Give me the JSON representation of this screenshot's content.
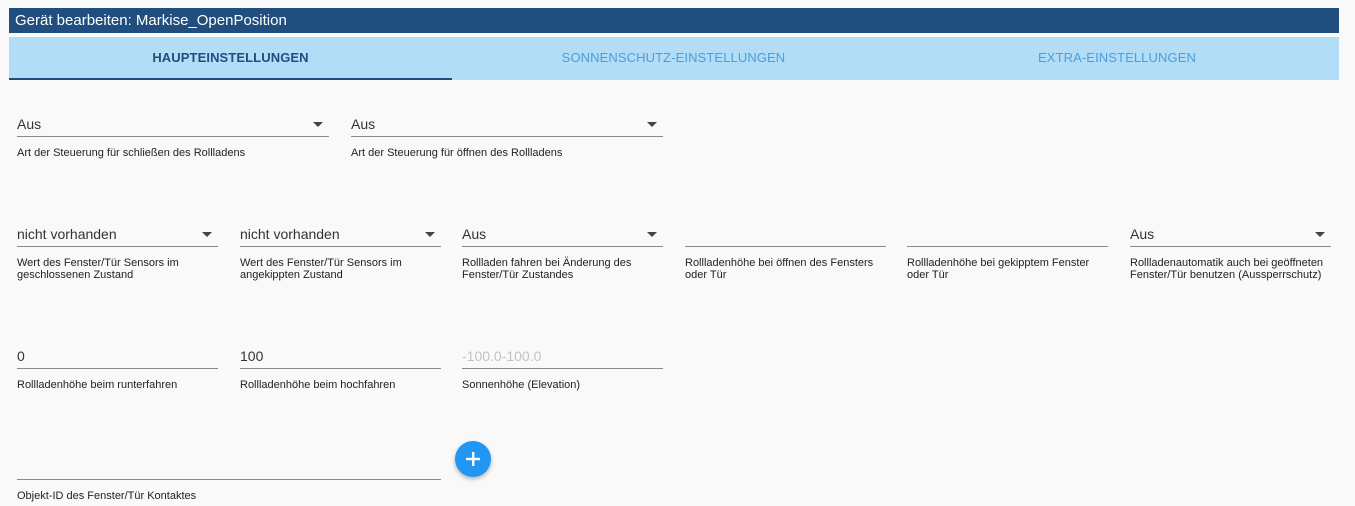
{
  "window": {
    "title": "Gerät bearbeiten: Markise_OpenPosition"
  },
  "tabs": [
    {
      "label": "HAUPTEINSTELLUNGEN"
    },
    {
      "label": "SONNENSCHUTZ-EINSTELLUNGEN"
    },
    {
      "label": "EXTRA-EINSTELLUNGEN"
    }
  ],
  "fields": {
    "close_control": {
      "value": "Aus",
      "label": "Art der Steuerung für schließen des Rollladens"
    },
    "open_control": {
      "value": "Aus",
      "label": "Art der Steuerung für öffnen des Rollladens"
    },
    "sensor_closed": {
      "value": "nicht vorhanden",
      "label": "Wert des Fenster/Tür Sensors im geschlossenen Zustand"
    },
    "sensor_tilted": {
      "value": "nicht vorhanden",
      "label": "Wert des Fenster/Tür Sensors im angekippten Zustand"
    },
    "drive_on_change": {
      "value": "Aus",
      "label": "Rollladen fahren bei Änderung des Fenster/Tür Zustandes"
    },
    "height_window_open": {
      "value": "",
      "label": "Rollladenhöhe bei öffnen des Fensters oder Tür"
    },
    "height_window_tilted": {
      "value": "",
      "label": "Rollladenhöhe bei gekipptem Fenster oder Tür"
    },
    "lockout_protection": {
      "value": "Aus",
      "label": "Rollladenautomatik auch bei geöffneten Fenster/Tür benutzen (Aussperrschutz)"
    },
    "height_down": {
      "value": "0",
      "label": "Rollladenhöhe beim runterfahren"
    },
    "height_up": {
      "value": "100",
      "label": "Rollladenhöhe beim hochfahren"
    },
    "sun_elevation": {
      "value": "",
      "placeholder": "-100.0-100.0",
      "label": "Sonnenhöhe (Elevation)"
    },
    "contact_object_id": {
      "value": "",
      "label": "Objekt-ID des Fenster/Tür Kontaktes"
    }
  },
  "actions": {
    "add_icon": "plus-icon"
  },
  "colors": {
    "titlebar": "#1f4e7f",
    "tabs_bg": "#b3dcf7",
    "tab_inactive": "#4b9fd8",
    "fab": "#2196f3"
  }
}
